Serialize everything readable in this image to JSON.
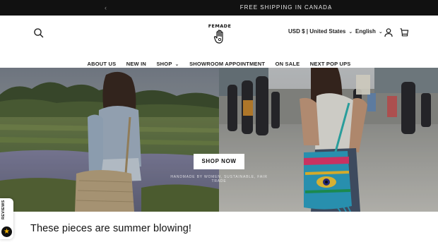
{
  "announcement": {
    "message": "FREE SHIPPING IN CANADA",
    "prev_icon": "chevron-left-icon",
    "next_icon": "chevron-right-icon"
  },
  "header": {
    "logo_text": "FEMADE",
    "currency": "USD $ | United States",
    "language": "English",
    "icons": [
      "search-icon",
      "account-icon",
      "cart-icon"
    ]
  },
  "nav": {
    "items": [
      {
        "label": "ABOUT US"
      },
      {
        "label": "NEW IN"
      },
      {
        "label": "SHOP",
        "has_dropdown": true
      },
      {
        "label": "SHOWROOM APPOINTMENT"
      },
      {
        "label": "ON SALE"
      },
      {
        "label": "NEXT POP UPS"
      }
    ]
  },
  "hero": {
    "button_label": "SHOP NOW",
    "tagline": "HANDMADE BY WOMEN, SUSTAINABLE, FAIR TRADE"
  },
  "reviews_tab": {
    "label": "REVIEWS",
    "icon": "star-icon"
  },
  "section": {
    "title": "These pieces are summer blowing!"
  },
  "colors": {
    "announcement_bg": "#111111",
    "text": "#121212",
    "button_bg": "#ffffff",
    "star": "#f5b400"
  }
}
